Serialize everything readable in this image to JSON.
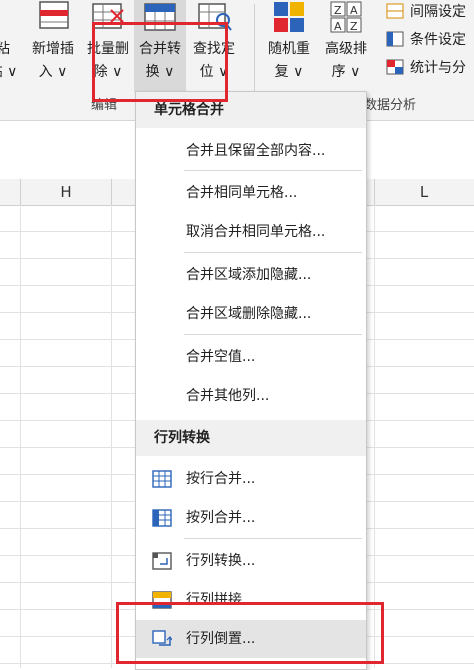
{
  "ribbon": {
    "buttons": [
      {
        "l1": "粘",
        "l2": "贴 ∨"
      },
      {
        "l1": "新增插",
        "l2": "入 ∨"
      },
      {
        "l1": "批量删",
        "l2": "除 ∨"
      },
      {
        "l1": "合并转",
        "l2": "换 ∨"
      },
      {
        "l1": "查找定",
        "l2": "位 ∨"
      },
      {
        "l1": "随机重",
        "l2": "复 ∨"
      },
      {
        "l1": "高级排",
        "l2": "序 ∨"
      }
    ],
    "small_items": [
      "间隔设定",
      "条件设定",
      "统计与分"
    ],
    "group_labels": {
      "edit": "编辑",
      "analysis": "数据分析"
    }
  },
  "sheet": {
    "columns": [
      "",
      "H",
      "",
      "",
      "",
      "",
      "L"
    ]
  },
  "menu": {
    "section1": "单元格合并",
    "items1": [
      "合并且保留全部内容...",
      "合并相同单元格...",
      "取消合并相同单元格...",
      "合并区域添加隐藏...",
      "合并区域删除隐藏...",
      "合并空值...",
      "合并其他列..."
    ],
    "section2": "行列转换",
    "items2": [
      "按行合并...",
      "按列合并...",
      "行列转换...",
      "行列拼接...",
      "行列倒置..."
    ]
  },
  "colors": {
    "highlight": "#e0262e",
    "accent": "#2b64b8"
  }
}
